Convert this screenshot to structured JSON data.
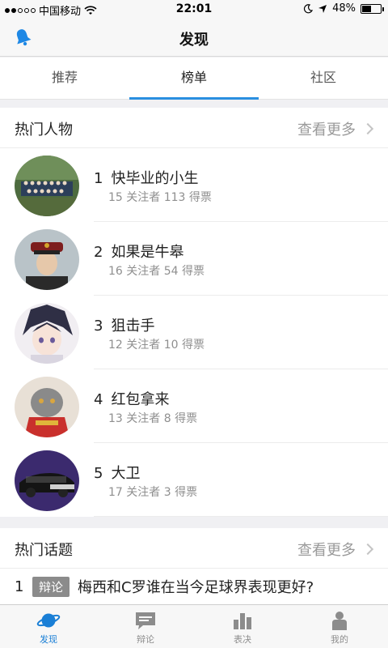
{
  "status_bar": {
    "carrier": "中国移动",
    "time": "22:01",
    "battery": "48%",
    "battery_level": 0.48
  },
  "nav": {
    "title": "发现"
  },
  "tabs": [
    {
      "label": "推荐",
      "active": false
    },
    {
      "label": "榜单",
      "active": true
    },
    {
      "label": "社区",
      "active": false
    }
  ],
  "hot_people": {
    "title": "热门人物",
    "more": "查看更多",
    "items": [
      {
        "rank": "1",
        "name": "快毕业的小生",
        "followers": "15",
        "followers_label": "关注者",
        "votes": "113",
        "votes_label": "得票"
      },
      {
        "rank": "2",
        "name": "如果是牛皋",
        "followers": "16",
        "followers_label": "关注者",
        "votes": "54",
        "votes_label": "得票"
      },
      {
        "rank": "3",
        "name": "狙击手",
        "followers": "12",
        "followers_label": "关注者",
        "votes": "10",
        "votes_label": "得票"
      },
      {
        "rank": "4",
        "name": "红包拿来",
        "followers": "13",
        "followers_label": "关注者",
        "votes": "8",
        "votes_label": "得票"
      },
      {
        "rank": "5",
        "name": "大卫",
        "followers": "17",
        "followers_label": "关注者",
        "votes": "3",
        "votes_label": "得票"
      }
    ]
  },
  "hot_topics": {
    "title": "热门话题",
    "more": "查看更多",
    "items": [
      {
        "rank": "1",
        "tag": "辩论",
        "title": "梅西和C罗谁在当今足球界表现更好?"
      }
    ]
  },
  "tabbar": [
    {
      "label": "发现",
      "icon": "planet-icon",
      "active": true
    },
    {
      "label": "辩论",
      "icon": "chat-icon",
      "active": false
    },
    {
      "label": "表决",
      "icon": "bar-chart-icon",
      "active": false
    },
    {
      "label": "我的",
      "icon": "person-icon",
      "active": false
    }
  ],
  "colors": {
    "accent": "#2a8fe0",
    "badge": "#8b8b8b"
  }
}
